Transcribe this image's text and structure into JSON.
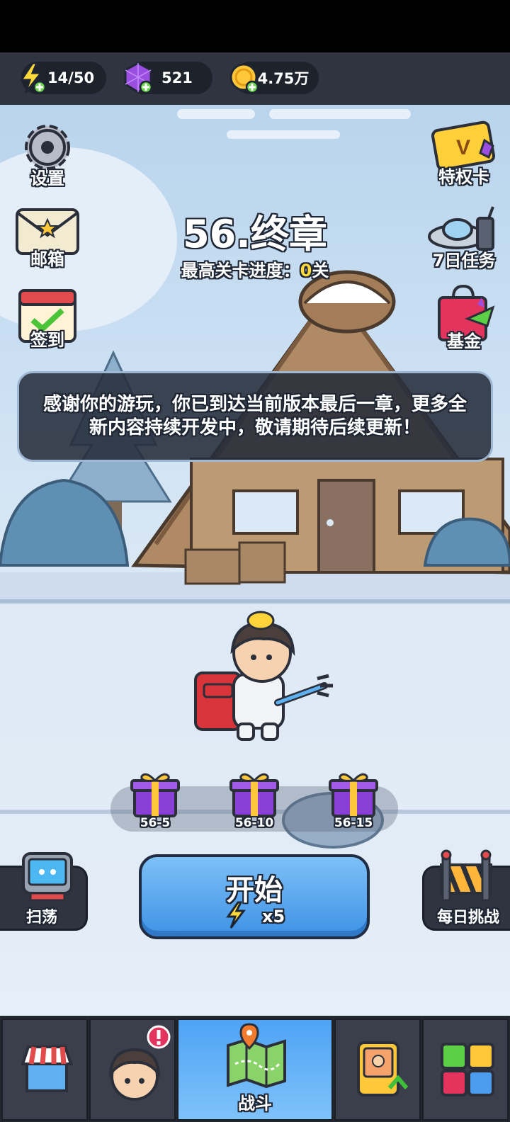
{
  "resources": {
    "energy": "14/50",
    "gems": "521",
    "coins": "4.75万"
  },
  "left_menu": {
    "settings": "设置",
    "mail": "邮箱",
    "checkin": "签到"
  },
  "right_menu": {
    "privilege": "特权卡",
    "seven_day": "7日任务",
    "fund": "基金"
  },
  "chapter": {
    "title": "56.终章",
    "progress_label": "最高关卡进度：",
    "progress_value": "0",
    "progress_unit": "关"
  },
  "notice": "感谢你的游玩，你已到达当前版本最后一章，更多全新内容持续开发中，敬请期待后续更新！",
  "rewards": [
    "56-5",
    "56-10",
    "56-15"
  ],
  "start_button": {
    "label": "开始",
    "cost": "x5"
  },
  "sweep_label": "扫荡",
  "daily_label": "每日挑战",
  "nav": {
    "battle": "战斗"
  },
  "colors": {
    "accent_blue": "#4ea3f5",
    "gold": "#ffd83a",
    "gem_purple": "#9b4fe0"
  }
}
